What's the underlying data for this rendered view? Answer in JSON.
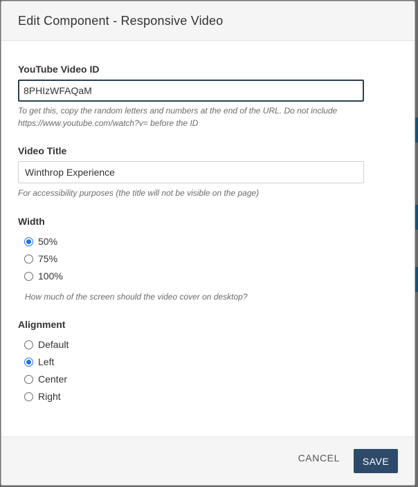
{
  "modal": {
    "title": "Edit Component - Responsive Video"
  },
  "fields": {
    "video_id": {
      "label": "YouTube Video ID",
      "value": "8PHIzWFAQaM",
      "help": "To get this, copy the random letters and numbers at the end of the URL. Do not include https://www.youtube.com/watch?v= before the ID"
    },
    "video_title": {
      "label": "Video Title",
      "value": "Winthrop Experience",
      "help": "For accessibility purposes (the title will not be visible on the page)"
    },
    "width": {
      "label": "Width",
      "options": [
        "50%",
        "75%",
        "100%"
      ],
      "selected": "50%",
      "help": "How much of the screen should the video cover on desktop?"
    },
    "alignment": {
      "label": "Alignment",
      "options": [
        "Default",
        "Left",
        "Center",
        "Right"
      ],
      "selected": "Left"
    }
  },
  "footer": {
    "cancel_label": "CANCEL",
    "save_label": "SAVE"
  },
  "colors": {
    "primary_button": "#2e4a6b",
    "radio_checked": "#1a73e8"
  }
}
